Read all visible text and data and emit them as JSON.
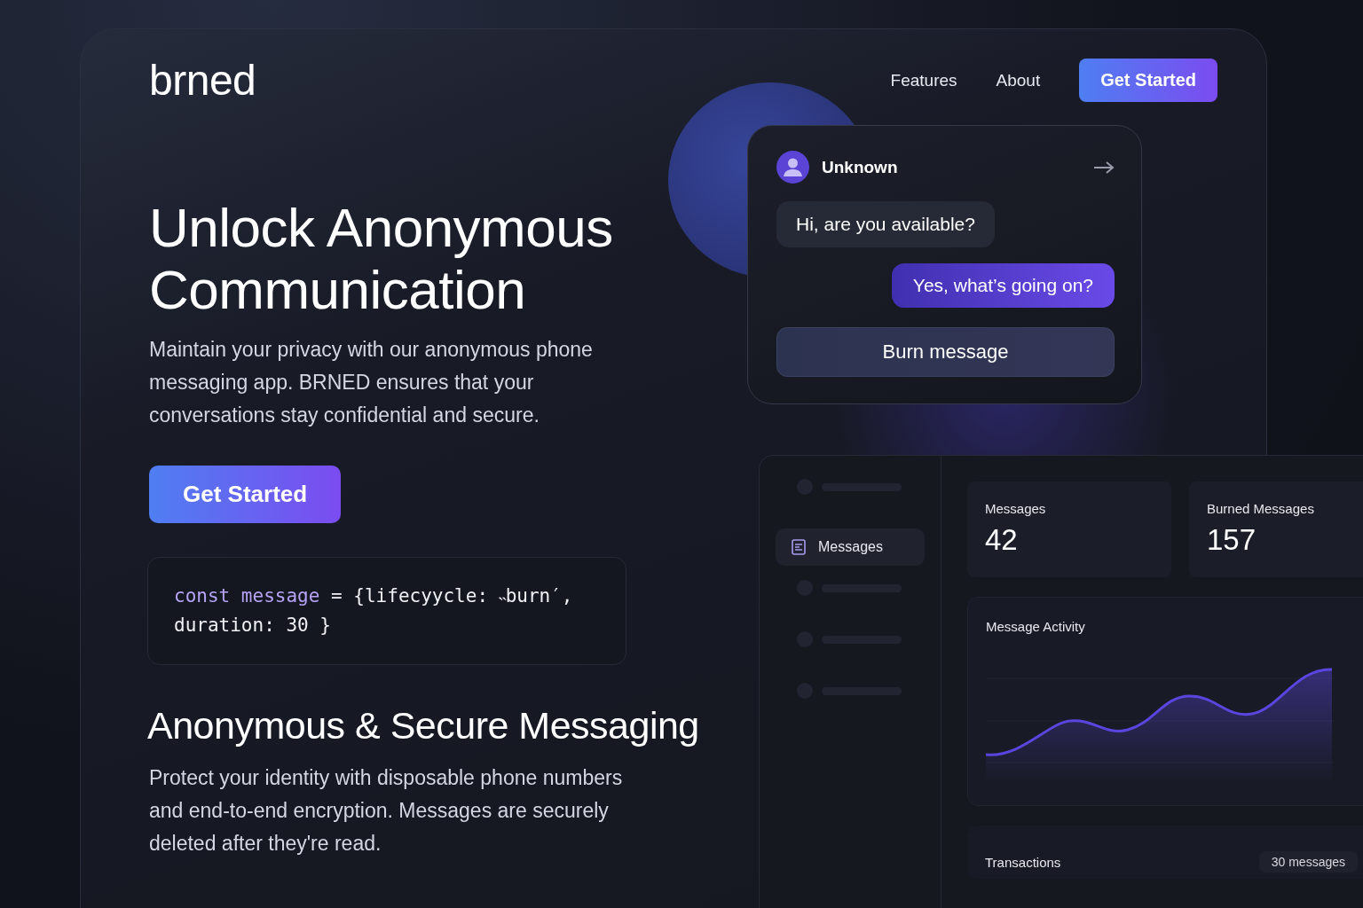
{
  "header": {
    "logo": "brned",
    "nav": [
      {
        "label": "Features"
      },
      {
        "label": "About"
      }
    ],
    "cta": "Get Started"
  },
  "hero": {
    "title": "Unlock Anonymous Communication",
    "text": "Maintain your privacy with our anonymous phone messaging app. BRNED ensures that your conversations stay confidential and secure.",
    "cta": "Get Started",
    "code": [
      [
        {
          "text": "const message",
          "kind": "keyword"
        },
        {
          "text": " = {lifecyycle: ˵burn′,",
          "kind": "plain"
        }
      ],
      [
        {
          "text": "duration: 30 }",
          "kind": "plain"
        }
      ]
    ]
  },
  "feature": {
    "title": "Anonymous  & Secure Messaging",
    "text": "Protect your identity with disposable phone numbers and end-to-end encryption. Messages are securely deleted after they're read."
  },
  "chat": {
    "contact": "Unknown",
    "messages": [
      {
        "kind": "received",
        "text": "Hi, are you available?"
      },
      {
        "kind": "sent",
        "text": "Yes, what’s going on?"
      }
    ],
    "action": "Burn message"
  },
  "dashboard": {
    "sidebar": [
      {
        "kind": "skeleton",
        "selected": false
      },
      {
        "kind": "item",
        "label": "Messages",
        "selected": true
      },
      {
        "kind": "skeleton",
        "selected": false
      },
      {
        "kind": "skeleton",
        "selected": false
      },
      {
        "kind": "skeleton",
        "selected": false
      }
    ],
    "stats": [
      {
        "label": "Messages",
        "value": "42"
      },
      {
        "label": "Burned Messages",
        "value": "157"
      }
    ],
    "activity": {
      "title": "Message Activity"
    },
    "transactions": {
      "title": "Transactions",
      "badge": "30 messages"
    }
  }
}
